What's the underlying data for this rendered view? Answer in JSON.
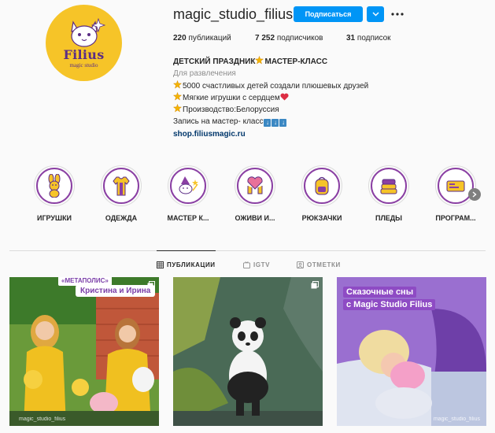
{
  "profile": {
    "username": "magic_studio_filius",
    "follow_label": "Подписаться",
    "avatar": {
      "brand": "Filius",
      "subtitle": "magic studio"
    }
  },
  "stats": {
    "posts_count": "220",
    "posts_label": "публикаций",
    "followers_count": "7 252",
    "followers_label": "подписчиков",
    "following_count": "31",
    "following_label": "подписок"
  },
  "bio": {
    "title": "ДЕТСКИЙ ПРАЗДНИК",
    "title_suffix": "МАСТЕР-КЛАСС",
    "category": "Для развлечения",
    "line1": "5000 счастливых детей создали плюшевых друзей",
    "line2": "Мягкие игрушки с сердцем",
    "line3": "Производство:Белоруссия",
    "line4": "Запись на мастер- класс",
    "link": "shop.filiusmagic.ru"
  },
  "highlights": [
    {
      "label": "ИГРУШКИ",
      "icon": "bunny-toy-icon"
    },
    {
      "label": "ОДЕЖДА",
      "icon": "shirt-icon"
    },
    {
      "label": "МАСТЕР К...",
      "icon": "wizard-cat-icon"
    },
    {
      "label": "ОЖИВИ И...",
      "icon": "heart-hands-icon"
    },
    {
      "label": "РЮКЗАЧКИ",
      "icon": "backpack-icon"
    },
    {
      "label": "ПЛЕДЫ",
      "icon": "blanket-stack-icon"
    },
    {
      "label": "ПРОГРАМ...",
      "icon": "ticket-icon"
    }
  ],
  "tabs": [
    {
      "label": "ПУБЛИКАЦИИ",
      "active": true,
      "icon": "grid-icon"
    },
    {
      "label": "IGTV",
      "active": false,
      "icon": "igtv-icon"
    },
    {
      "label": "ОТМЕТКИ",
      "active": false,
      "icon": "tag-user-icon"
    }
  ],
  "posts": [
    {
      "sign": "«МЕТАПОЛИС»",
      "banner": "Кристина и Ирина",
      "watermark": "magic_studio_filius"
    },
    {
      "watermark": ""
    },
    {
      "caption_line1": "Сказочные сны",
      "caption_line2": "с Magic Studio Filius",
      "watermark": "magic_studio_filius"
    }
  ],
  "colors": {
    "follow_blue": "#0095f6",
    "brand_yellow": "#f6c428",
    "brand_purple": "#5b2d86",
    "highlight_ring": "#8a3fa3"
  }
}
